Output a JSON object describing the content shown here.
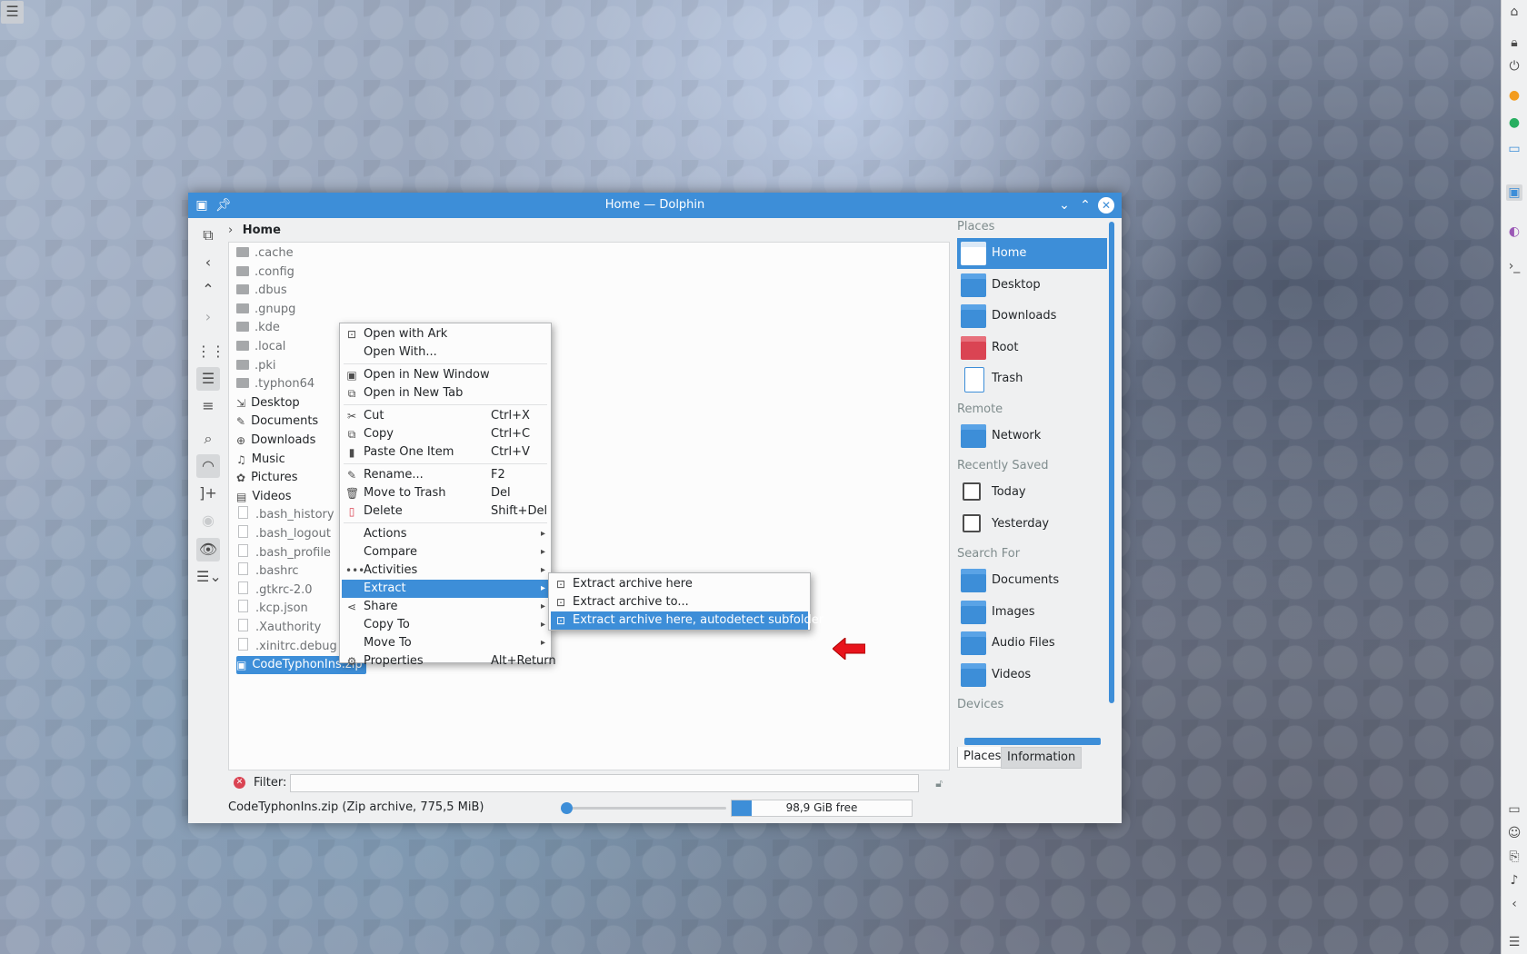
{
  "window": {
    "title": "Home — Dolphin",
    "breadcrumb": "Home"
  },
  "files": [
    {
      "name": ".cache",
      "type": "folder",
      "hidden": true
    },
    {
      "name": ".config",
      "type": "folder",
      "hidden": true
    },
    {
      "name": ".dbus",
      "type": "folder",
      "hidden": true
    },
    {
      "name": ".gnupg",
      "type": "folder",
      "hidden": true
    },
    {
      "name": ".kde",
      "type": "folder",
      "hidden": true
    },
    {
      "name": ".local",
      "type": "folder",
      "hidden": true
    },
    {
      "name": ".pki",
      "type": "folder",
      "hidden": true
    },
    {
      "name": ".typhon64",
      "type": "folder",
      "hidden": true
    },
    {
      "name": "Desktop",
      "type": "folder-desktop",
      "hidden": false
    },
    {
      "name": "Documents",
      "type": "folder-documents",
      "hidden": false
    },
    {
      "name": "Downloads",
      "type": "folder-downloads",
      "hidden": false
    },
    {
      "name": "Music",
      "type": "folder-music",
      "hidden": false
    },
    {
      "name": "Pictures",
      "type": "folder-pictures",
      "hidden": false
    },
    {
      "name": "Videos",
      "type": "folder-videos",
      "hidden": false
    },
    {
      "name": ".bash_history",
      "type": "file",
      "hidden": true
    },
    {
      "name": ".bash_logout",
      "type": "file",
      "hidden": true
    },
    {
      "name": ".bash_profile",
      "type": "file",
      "hidden": true
    },
    {
      "name": ".bashrc",
      "type": "file",
      "hidden": true
    },
    {
      "name": ".gtkrc-2.0",
      "type": "file",
      "hidden": true
    },
    {
      "name": ".kcp.json",
      "type": "file",
      "hidden": true
    },
    {
      "name": ".Xauthority",
      "type": "file",
      "hidden": true
    },
    {
      "name": ".xinitrc.debug",
      "type": "file",
      "hidden": true
    },
    {
      "name": "CodeTyphonIns.zip",
      "type": "archive",
      "hidden": false,
      "selected": true
    }
  ],
  "filter": {
    "label": "Filter:",
    "value": ""
  },
  "status": {
    "text": "CodeTyphonIns.zip (Zip archive, 775,5 MiB)",
    "free_space": "98,9 GiB free",
    "used_fraction": 0.11
  },
  "places": {
    "sections": [
      {
        "header": "Places",
        "items": [
          {
            "label": "Home",
            "icon": "home-folder-icon",
            "selected": true
          },
          {
            "label": "Desktop",
            "icon": "desktop-folder-icon"
          },
          {
            "label": "Downloads",
            "icon": "downloads-folder-icon"
          },
          {
            "label": "Root",
            "icon": "root-folder-icon"
          },
          {
            "label": "Trash",
            "icon": "trash-icon"
          }
        ]
      },
      {
        "header": "Remote",
        "items": [
          {
            "label": "Network",
            "icon": "network-folder-icon"
          }
        ]
      },
      {
        "header": "Recently Saved",
        "items": [
          {
            "label": "Today",
            "icon": "calendar-icon"
          },
          {
            "label": "Yesterday",
            "icon": "calendar-icon"
          }
        ]
      },
      {
        "header": "Search For",
        "items": [
          {
            "label": "Documents",
            "icon": "documents-folder-icon"
          },
          {
            "label": "Images",
            "icon": "images-folder-icon"
          },
          {
            "label": "Audio Files",
            "icon": "audio-folder-icon"
          },
          {
            "label": "Videos",
            "icon": "videos-folder-icon"
          }
        ]
      },
      {
        "header": "Devices",
        "items": []
      }
    ],
    "tabs": [
      "Places",
      "Information"
    ]
  },
  "context_menu": [
    {
      "label": "Open with Ark",
      "icon": "ark-icon"
    },
    {
      "label": "Open With...",
      "icon": ""
    },
    {
      "sep": true
    },
    {
      "label": "Open in New Window",
      "icon": "window-icon"
    },
    {
      "label": "Open in New Tab",
      "icon": "tab-icon"
    },
    {
      "sep": true
    },
    {
      "label": "Cut",
      "shortcut": "Ctrl+X",
      "icon": "cut-icon"
    },
    {
      "label": "Copy",
      "shortcut": "Ctrl+C",
      "icon": "copy-icon"
    },
    {
      "label": "Paste One Item",
      "shortcut": "Ctrl+V",
      "icon": "paste-icon"
    },
    {
      "sep": true
    },
    {
      "label": "Rename...",
      "shortcut": "F2",
      "icon": "rename-icon"
    },
    {
      "label": "Move to Trash",
      "shortcut": "Del",
      "icon": "trash-icon"
    },
    {
      "label": "Delete",
      "shortcut": "Shift+Del",
      "icon": "delete-icon"
    },
    {
      "sep": true
    },
    {
      "label": "Actions",
      "submenu": true,
      "icon": ""
    },
    {
      "label": "Compare",
      "submenu": true,
      "icon": ""
    },
    {
      "label": "Activities",
      "submenu": true,
      "icon": "activities-icon"
    },
    {
      "label": "Extract",
      "submenu": true,
      "icon": "",
      "highlight": true
    },
    {
      "label": "Share",
      "submenu": true,
      "icon": "share-icon"
    },
    {
      "label": "Copy To",
      "submenu": true,
      "icon": ""
    },
    {
      "label": "Move To",
      "submenu": true,
      "icon": ""
    },
    {
      "label": "Properties",
      "shortcut": "Alt+Return",
      "icon": "properties-icon"
    }
  ],
  "extract_submenu": [
    {
      "label": "Extract archive here",
      "icon": "ark-icon"
    },
    {
      "label": "Extract archive to...",
      "icon": "ark-icon"
    },
    {
      "label": "Extract archive here, autodetect subfolder",
      "icon": "ark-icon",
      "highlight": true
    }
  ],
  "colors": {
    "accent": "#3d8ed8",
    "pointer_arrow": "#e8141c"
  }
}
